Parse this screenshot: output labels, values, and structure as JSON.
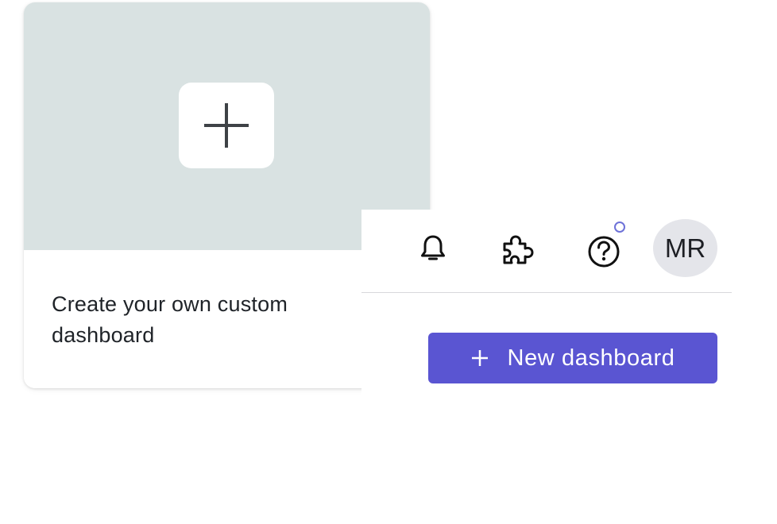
{
  "card": {
    "title": "Create your own custom dashboard",
    "add_icon": "plus-icon"
  },
  "header": {
    "icons": [
      "bell-icon",
      "puzzle-icon",
      "help-icon"
    ],
    "help_has_notification": true,
    "avatar_initials": "MR"
  },
  "actions": {
    "new_dashboard_label": "New dashboard",
    "new_dashboard_icon": "plus-icon"
  },
  "colors": {
    "accent": "#5a55d2",
    "card_hero_bg": "#d9e2e2",
    "notification_dot": "#6e72d8",
    "avatar_bg": "#e4e5ea"
  }
}
